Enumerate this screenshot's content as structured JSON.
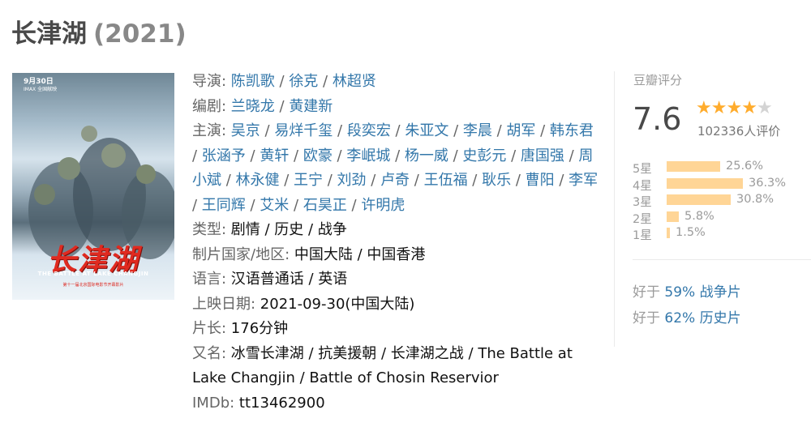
{
  "header": {
    "title": "长津湖",
    "year": "(2021)"
  },
  "poster": {
    "date": "9月30日",
    "subtitle": "IMAX 全国献映",
    "title": "长津湖",
    "title_en": "THE BATTLE AT LAKE CHANGJIN",
    "footer": "第十一届北京国际电影节开幕影片"
  },
  "info": {
    "director_label": "导演",
    "directors": [
      "陈凯歌",
      "徐克",
      "林超贤"
    ],
    "writer_label": "编剧",
    "writers": [
      "兰晓龙",
      "黄建新"
    ],
    "cast_label": "主演",
    "cast": [
      "吴京",
      "易烊千玺",
      "段奕宏",
      "朱亚文",
      "李晨",
      "胡军",
      "韩东君",
      "张涵予",
      "黄轩",
      "欧豪",
      "李岷城",
      "杨一威",
      "史彭元",
      "唐国强",
      "周小斌",
      "林永健",
      "王宁",
      "刘劲",
      "卢奇",
      "王伍福",
      "耿乐",
      "曹阳",
      "李军",
      "王同辉",
      "艾米",
      "石昊正",
      "许明虎"
    ],
    "genre_label": "类型",
    "genres": "剧情 / 历史 / 战争",
    "country_label": "制片国家/地区",
    "country": "中国大陆 / 中国香港",
    "language_label": "语言",
    "language": "汉语普通话 / 英语",
    "release_label": "上映日期",
    "release": "2021-09-30(中国大陆)",
    "runtime_label": "片长",
    "runtime": "176分钟",
    "aka_label": "又名",
    "aka": "冰雪长津湖 / 抗美援朝 / 长津湖之战 / The Battle at Lake Changjin / Battle of Chosin Reservior",
    "imdb_label": "IMDb",
    "imdb": "tt13462900"
  },
  "rating": {
    "label": "豆瓣评分",
    "score": "7.6",
    "stars_filled": 4,
    "stars_total": 5,
    "votes": "102336人评价",
    "distribution": [
      {
        "label": "5星",
        "percent": 25.6,
        "text": "25.6%"
      },
      {
        "label": "4星",
        "percent": 36.3,
        "text": "36.3%"
      },
      {
        "label": "3星",
        "percent": 30.8,
        "text": "30.8%"
      },
      {
        "label": "2星",
        "percent": 5.8,
        "text": "5.8%"
      },
      {
        "label": "1星",
        "percent": 1.5,
        "text": "1.5%"
      }
    ],
    "better_than": [
      {
        "prefix": "好于",
        "value": "59% 战争片"
      },
      {
        "prefix": "好于",
        "value": "62% 历史片"
      }
    ]
  },
  "colors": {
    "link": "#3377aa",
    "star": "#ffac2d",
    "bar": "#ffd596"
  }
}
